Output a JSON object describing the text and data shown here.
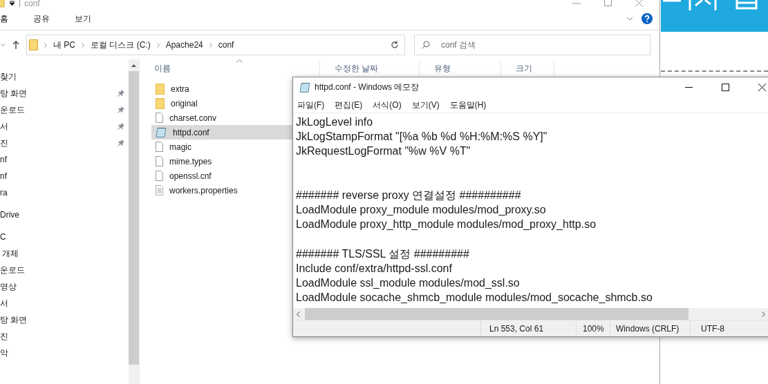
{
  "explorer": {
    "title": "conf",
    "ribbon_tabs": [
      {
        "label": "홈"
      },
      {
        "label": "공유"
      },
      {
        "label": "보기"
      }
    ],
    "breadcrumb": [
      "내 PC",
      "로컬 디스크 (C:)",
      "Apache24",
      "conf"
    ],
    "search": {
      "placeholder": "conf 검색"
    },
    "sidebar": [
      {
        "label": "찾기",
        "pinned": false
      },
      {
        "label": "탕 화면",
        "pinned": true
      },
      {
        "label": "운로드",
        "pinned": true
      },
      {
        "label": "서",
        "pinned": true
      },
      {
        "label": "진",
        "pinned": true
      },
      {
        "label": "nf",
        "pinned": false
      },
      {
        "label": "nf",
        "pinned": false
      },
      {
        "label": "ra",
        "pinned": false
      },
      {
        "label": "Drive",
        "pinned": false
      },
      {
        "label": "C",
        "pinned": false
      },
      {
        "label": " 개체",
        "pinned": false
      },
      {
        "label": "운로드",
        "pinned": false
      },
      {
        "label": "영상",
        "pinned": false
      },
      {
        "label": "서",
        "pinned": false
      },
      {
        "label": "탕 화면",
        "pinned": false
      },
      {
        "label": "진",
        "pinned": false
      },
      {
        "label": "악",
        "pinned": false
      }
    ],
    "columns": [
      "이름",
      "수정한 날짜",
      "유형",
      "크기"
    ],
    "files": [
      {
        "name": "extra",
        "kind": "folder",
        "selected": false
      },
      {
        "name": "original",
        "kind": "folder",
        "selected": false
      },
      {
        "name": "charset.conv",
        "kind": "file",
        "selected": false
      },
      {
        "name": "httpd.conf",
        "kind": "notepad",
        "selected": true
      },
      {
        "name": "magic",
        "kind": "file",
        "selected": false
      },
      {
        "name": "mime.types",
        "kind": "file",
        "selected": false
      },
      {
        "name": "openssl.cnf",
        "kind": "file",
        "selected": false
      },
      {
        "name": "workers.properties",
        "kind": "text",
        "selected": false
      }
    ]
  },
  "notepad": {
    "title": "httpd.conf - Windows 메모장",
    "menu": [
      "파일(F)",
      "편집(E)",
      "서식(O)",
      "보기(V)",
      "도움말(H)"
    ],
    "sections": [
      {
        "kind": "first",
        "lines": [
          "JkLogLevel info",
          "JkLogStampFormat \"[%a %b %d %H:%M:%S %Y]\"",
          "JkRequestLogFormat \"%w %V %T\""
        ]
      },
      {
        "kind": "after-two-blank-lines",
        "lines": [
          "####### reverse proxy 연결설정 ##########",
          "LoadModule proxy_module modules/mod_proxy.so",
          "LoadModule proxy_http_module modules/mod_proxy_http.so"
        ]
      },
      {
        "kind": "after-blank-line",
        "lines": [
          "####### TLS/SSL 설정 #########",
          "Include conf/extra/httpd-ssl.conf",
          "LoadModule ssl_module modules/mod_ssl.so",
          "LoadModule socache_shmcb_module modules/mod_socache_shmcb.so"
        ]
      }
    ],
    "status": {
      "position": "Ln 553, Col 61",
      "zoom": "100%",
      "line_ending": "Windows (CRLF)",
      "encoding": "UTF-8"
    }
  }
}
